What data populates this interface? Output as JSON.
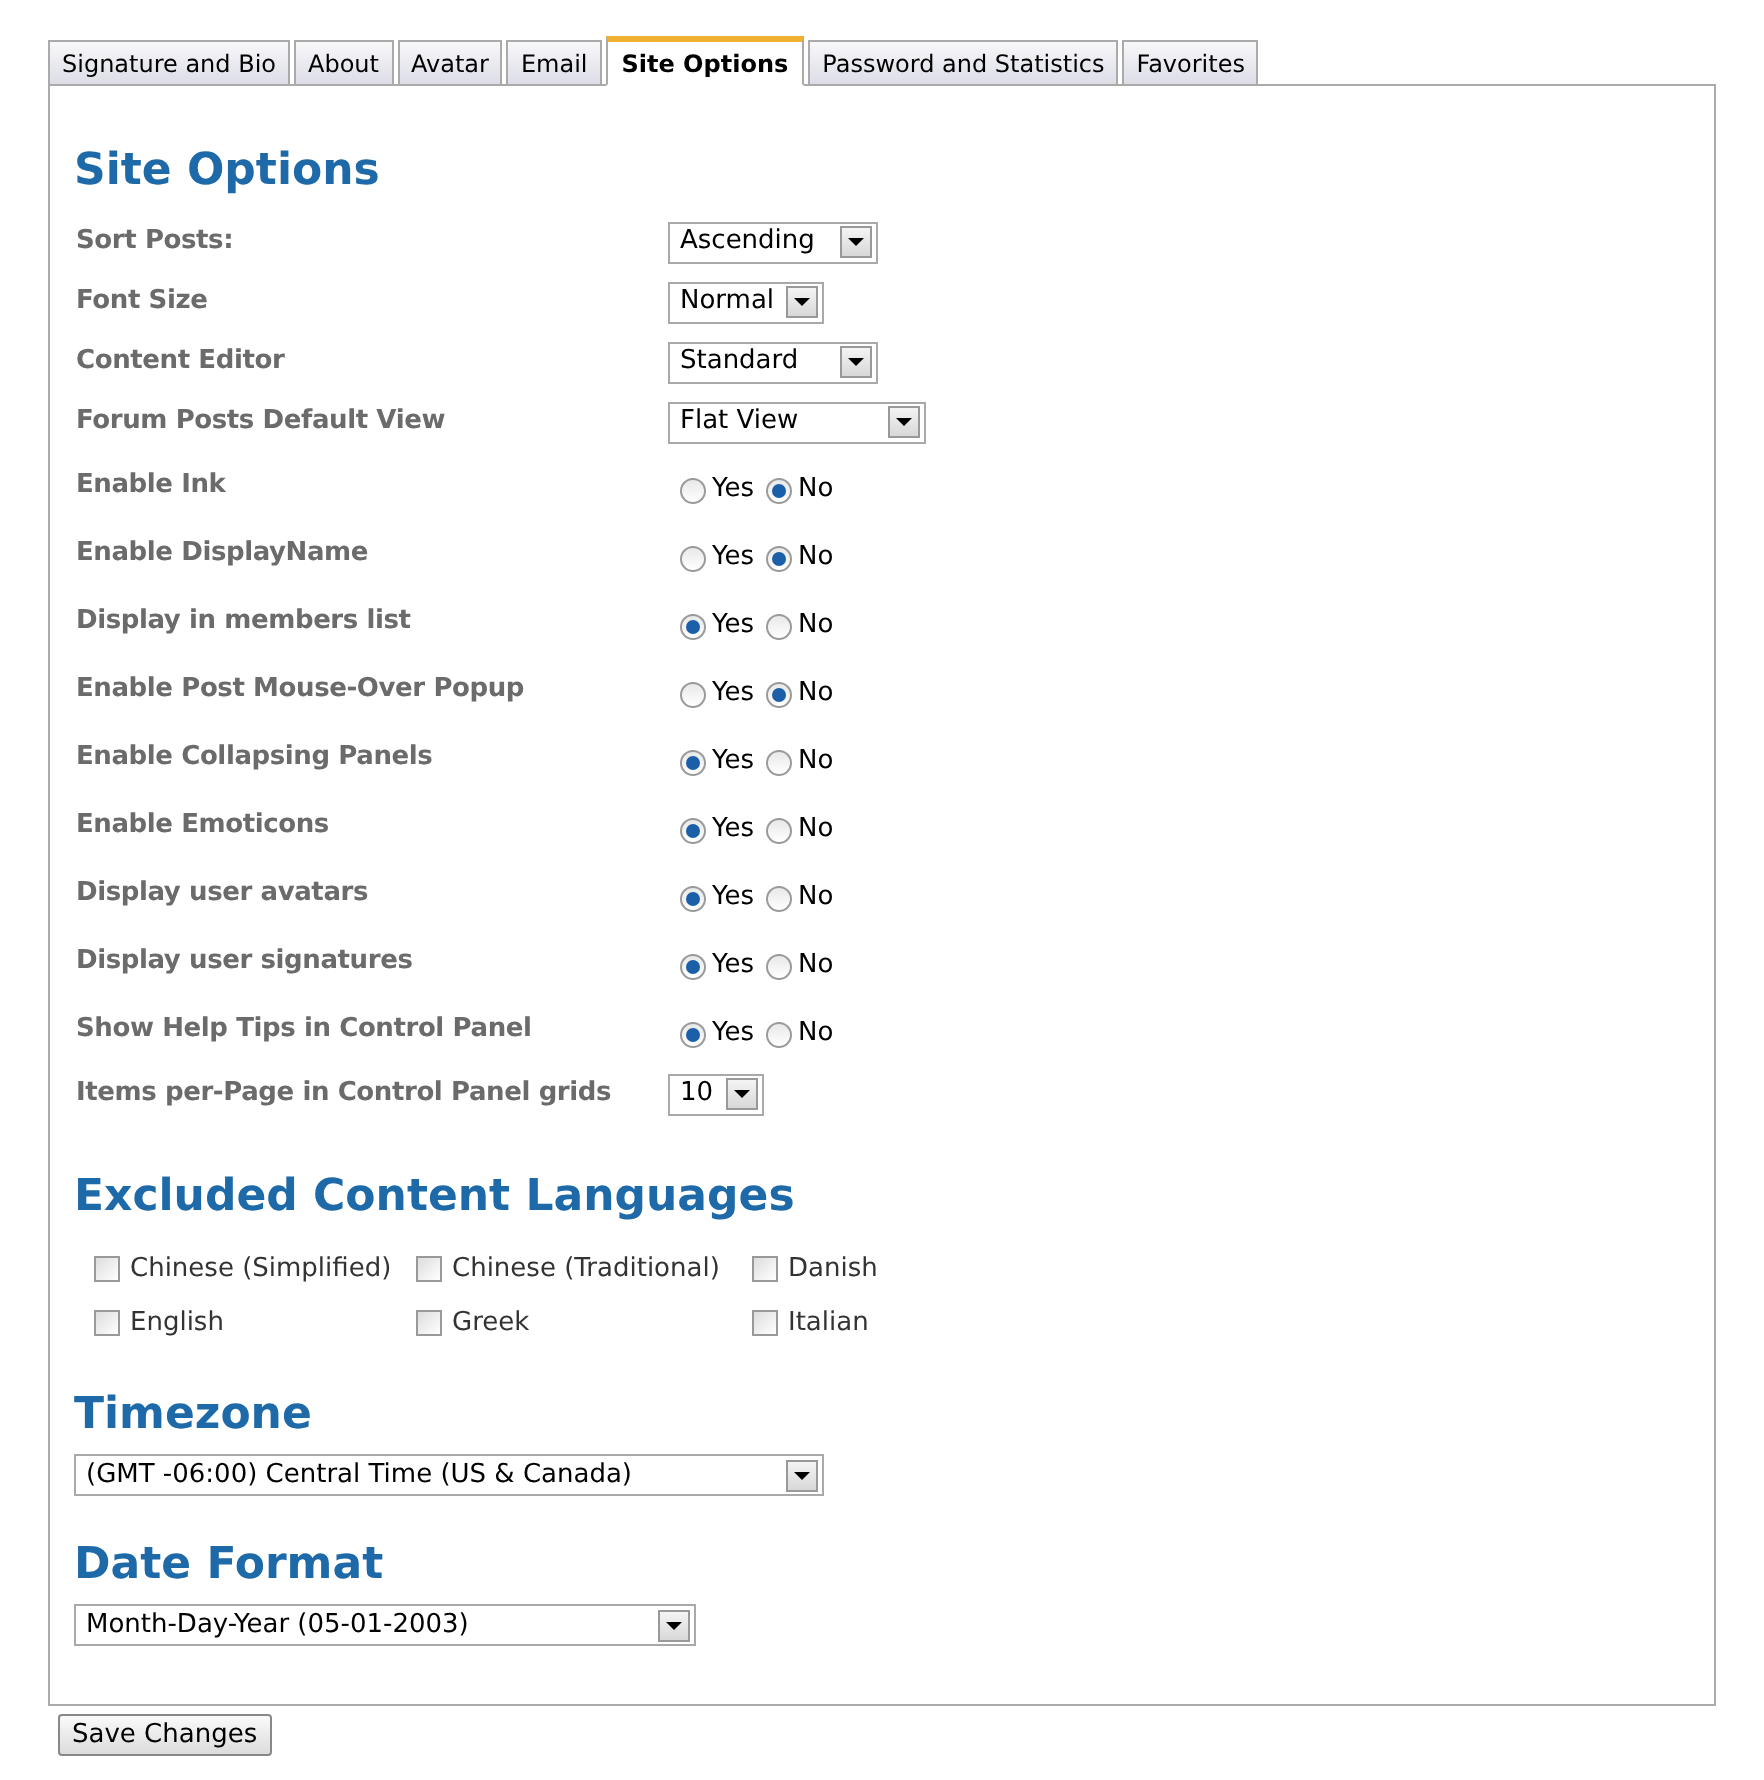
{
  "tabs": [
    {
      "label": "Signature and Bio",
      "selected": false
    },
    {
      "label": "About",
      "selected": false
    },
    {
      "label": "Avatar",
      "selected": false
    },
    {
      "label": "Email",
      "selected": false
    },
    {
      "label": "Site Options",
      "selected": true
    },
    {
      "label": "Password and Statistics",
      "selected": false
    },
    {
      "label": "Favorites",
      "selected": false
    }
  ],
  "site_options": {
    "heading": "Site Options",
    "settings": [
      {
        "kind": "select",
        "label": "Sort Posts:",
        "value": "Ascending"
      },
      {
        "kind": "select",
        "label": "Font Size",
        "value": "Normal"
      },
      {
        "kind": "select",
        "label": "Content Editor",
        "value": "Standard"
      },
      {
        "kind": "select",
        "label": "Forum Posts Default View",
        "value": "Flat View"
      },
      {
        "kind": "radio",
        "label": "Enable Ink",
        "options": [
          {
            "label": "Yes",
            "selected": false
          },
          {
            "label": "No",
            "selected": true
          }
        ]
      },
      {
        "kind": "radio",
        "label": "Enable DisplayName",
        "options": [
          {
            "label": "Yes",
            "selected": false
          },
          {
            "label": "No",
            "selected": true
          }
        ]
      },
      {
        "kind": "radio",
        "label": "Display in members list",
        "options": [
          {
            "label": "Yes",
            "selected": true
          },
          {
            "label": "No",
            "selected": false
          }
        ]
      },
      {
        "kind": "radio",
        "label": "Enable Post Mouse-Over Popup",
        "options": [
          {
            "label": "Yes",
            "selected": false
          },
          {
            "label": "No",
            "selected": true
          }
        ]
      },
      {
        "kind": "radio",
        "label": "Enable Collapsing Panels",
        "options": [
          {
            "label": "Yes",
            "selected": true
          },
          {
            "label": "No",
            "selected": false
          }
        ]
      },
      {
        "kind": "radio",
        "label": "Enable Emoticons",
        "options": [
          {
            "label": "Yes",
            "selected": true
          },
          {
            "label": "No",
            "selected": false
          }
        ]
      },
      {
        "kind": "radio",
        "label": "Display user avatars",
        "options": [
          {
            "label": "Yes",
            "selected": true
          },
          {
            "label": "No",
            "selected": false
          }
        ]
      },
      {
        "kind": "radio",
        "label": "Display user signatures",
        "options": [
          {
            "label": "Yes",
            "selected": true
          },
          {
            "label": "No",
            "selected": false
          }
        ]
      },
      {
        "kind": "radio",
        "label": "Show Help Tips in Control Panel",
        "options": [
          {
            "label": "Yes",
            "selected": true
          },
          {
            "label": "No",
            "selected": false
          }
        ]
      },
      {
        "kind": "select",
        "label": "Items per-Page in Control Panel grids",
        "value": "10"
      }
    ]
  },
  "excluded_languages": {
    "heading": "Excluded Content Languages",
    "items": [
      {
        "label": "Chinese (Simplified)",
        "checked": false
      },
      {
        "label": "Chinese (Traditional)",
        "checked": false
      },
      {
        "label": "Danish",
        "checked": false
      },
      {
        "label": "English",
        "checked": false
      },
      {
        "label": "Greek",
        "checked": false
      },
      {
        "label": "Italian",
        "checked": false
      }
    ]
  },
  "timezone": {
    "heading": "Timezone",
    "value": "(GMT -06:00) Central Time (US & Canada)"
  },
  "date_format": {
    "heading": "Date Format",
    "value": "Month-Day-Year (05-01-2003)"
  },
  "save_button": "Save Changes"
}
